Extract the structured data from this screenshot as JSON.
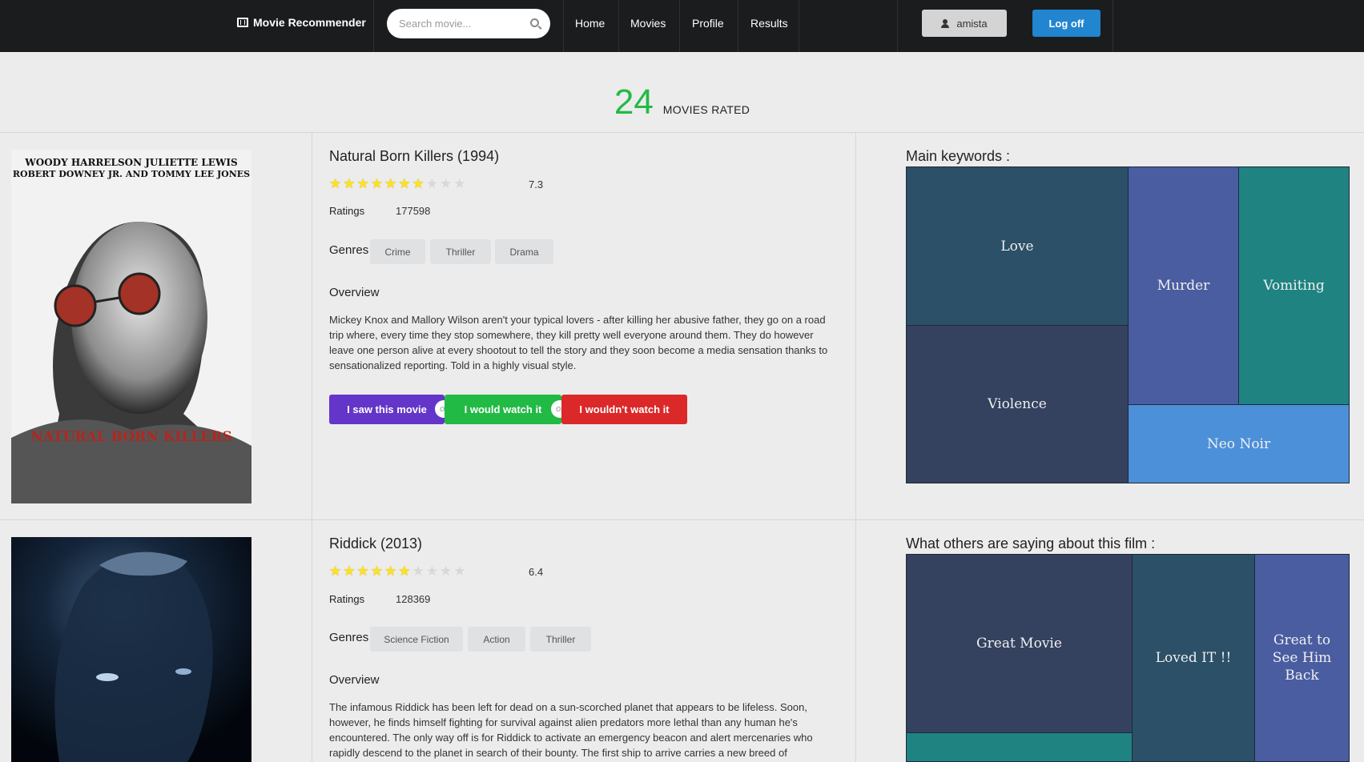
{
  "navbar": {
    "brand": "Movie Recommender",
    "search_placeholder": "Search movie...",
    "links": [
      "Home",
      "Movies",
      "Profile",
      "Results"
    ],
    "user": "amista",
    "logoff": "Log off"
  },
  "stat": {
    "value": "24",
    "label": "MOVIES RATED"
  },
  "labels": {
    "ratings": "Ratings",
    "genres": "Genres",
    "overview": "Overview",
    "or": "or"
  },
  "actions": {
    "saw": "I saw this movie",
    "would": "I would watch it",
    "wouldnt": "I wouldn't watch it"
  },
  "movies": [
    {
      "title": "Natural Born Killers (1994)",
      "rating": "7.3",
      "stars_filled": 7,
      "stars_total": 10,
      "ratings_count": "177598",
      "genres": [
        "Crime",
        "Thriller",
        "Drama"
      ],
      "overview": "Mickey Knox and Mallory Wilson aren't your typical lovers - after killing her abusive father, they go on a road trip where, every time they stop somewhere, they kill pretty well everyone around them. They do however leave one person alive at every shootout to tell the story and they soon become a media sensation thanks to sensationalized reporting. Told in a highly visual style.",
      "poster": {
        "cast_line1": "WOODY HARRELSON  JULIETTE LEWIS",
        "cast_line2": "ROBERT DOWNEY JR. AND TOMMY LEE JONES",
        "title_text": "NATURAL BORN KILLERS"
      },
      "panel_title": "Main keywords :",
      "treemap": [
        "Love",
        "Murder",
        "Vomiting",
        "Violence",
        "Neo Noir"
      ]
    },
    {
      "title": "Riddick (2013)",
      "rating": "6.4",
      "stars_filled": 6,
      "stars_total": 10,
      "ratings_count": "128369",
      "genres": [
        "Science Fiction",
        "Action",
        "Thriller"
      ],
      "overview": "The infamous Riddick has been left for dead on a sun-scorched planet that appears to be lifeless. Soon, however, he finds himself fighting for survival against alien predators more lethal than any human he's encountered. The only way off is for Riddick to activate an emergency beacon and alert mercenaries who rapidly descend to the planet in search of their bounty. The first ship to arrive carries a new breed of",
      "panel_title": "What others are saying about this film :",
      "treemap": [
        "Great Movie",
        "Loved IT !!",
        "Great to See Him Back",
        ""
      ]
    }
  ],
  "colors": {
    "navbar": "#1b1c1d",
    "green": "#21ba45",
    "blue": "#2185d0",
    "purple": "#6435c9",
    "red": "#db2828",
    "tm_teal_dark": "#2b5068",
    "tm_indigo": "#4a5da1",
    "tm_teal": "#1f8382",
    "tm_navy": "#34415f",
    "tm_sky": "#4c90d9"
  }
}
